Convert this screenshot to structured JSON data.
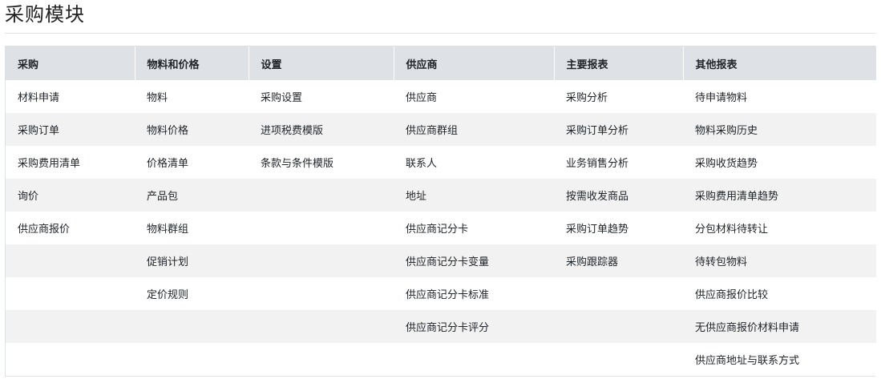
{
  "page": {
    "title": "采购模块"
  },
  "columns": [
    {
      "header": "采购",
      "items": [
        "材料申请",
        "采购订单",
        "采购费用清单",
        "询价",
        "供应商报价"
      ]
    },
    {
      "header": "物料和价格",
      "items": [
        "物料",
        "物料价格",
        "价格清单",
        "产品包",
        "物料群组",
        "促销计划",
        "定价规则"
      ]
    },
    {
      "header": "设置",
      "items": [
        "采购设置",
        "进项税费模版",
        "条款与条件模版"
      ]
    },
    {
      "header": "供应商",
      "items": [
        "供应商",
        "供应商群组",
        "联系人",
        "地址",
        "供应商记分卡",
        "供应商记分卡变量",
        "供应商记分卡标准",
        "供应商记分卡评分"
      ]
    },
    {
      "header": "主要报表",
      "items": [
        "采购分析",
        "采购订单分析",
        "业务销售分析",
        "按需收发商品",
        "采购订单趋势",
        "采购跟踪器"
      ]
    },
    {
      "header": "其他报表",
      "items": [
        "待申请物料",
        "物料采购历史",
        "采购收货趋势",
        "采购费用清单趋势",
        "分包材料待转让",
        "待转包物料",
        "供应商报价比较",
        "无供应商报价材料申请",
        "供应商地址与联系方式"
      ]
    }
  ]
}
